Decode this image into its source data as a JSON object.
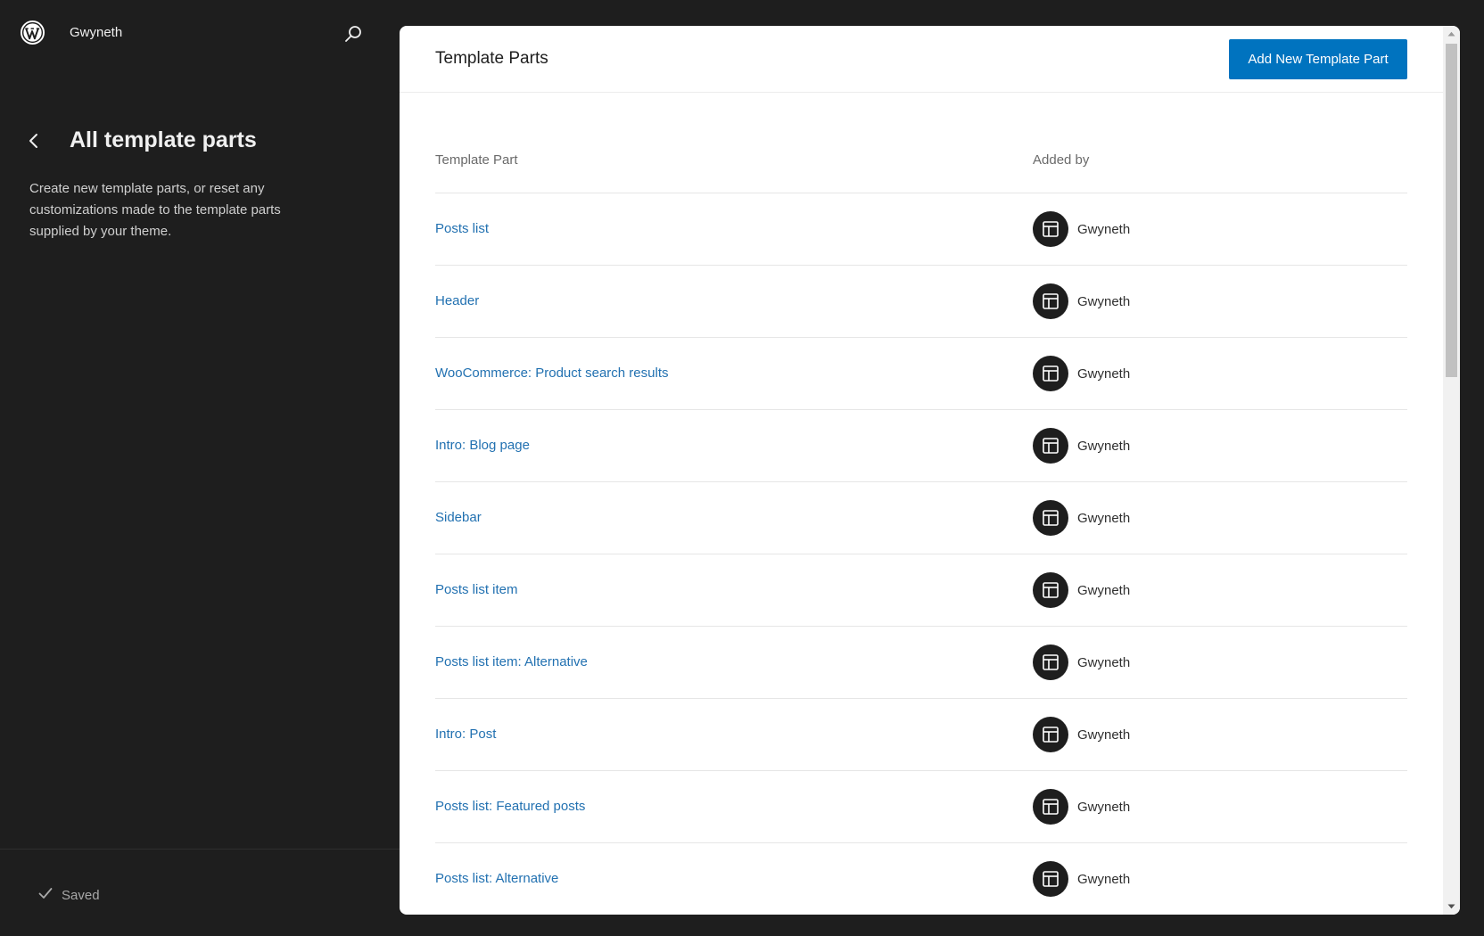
{
  "sidebar": {
    "site_name": "Gwyneth",
    "nav_title": "All template parts",
    "description": "Create new template parts, or reset any customizations made to the template parts supplied by your theme.",
    "status": "Saved"
  },
  "main": {
    "title": "Template Parts",
    "add_button": "Add New Template Part",
    "columns": {
      "part": "Template Part",
      "added_by": "Added by"
    },
    "rows": [
      {
        "name": "Posts list",
        "author": "Gwyneth"
      },
      {
        "name": "Header",
        "author": "Gwyneth"
      },
      {
        "name": "WooCommerce: Product search results",
        "author": "Gwyneth"
      },
      {
        "name": "Intro: Blog page",
        "author": "Gwyneth"
      },
      {
        "name": "Sidebar",
        "author": "Gwyneth"
      },
      {
        "name": "Posts list item",
        "author": "Gwyneth"
      },
      {
        "name": "Posts list item: Alternative",
        "author": "Gwyneth"
      },
      {
        "name": "Intro: Post",
        "author": "Gwyneth"
      },
      {
        "name": "Posts list: Featured posts",
        "author": "Gwyneth"
      },
      {
        "name": "Posts list: Alternative",
        "author": "Gwyneth"
      }
    ]
  },
  "colors": {
    "sidebar_bg": "#1e1e1e",
    "accent": "#0073bf",
    "link": "#2271b1"
  },
  "icons": {
    "logo": "wordpress-logo-icon",
    "search": "search-icon",
    "back": "chevron-left-icon",
    "saved": "checkmark-icon",
    "author": "layout-icon"
  }
}
